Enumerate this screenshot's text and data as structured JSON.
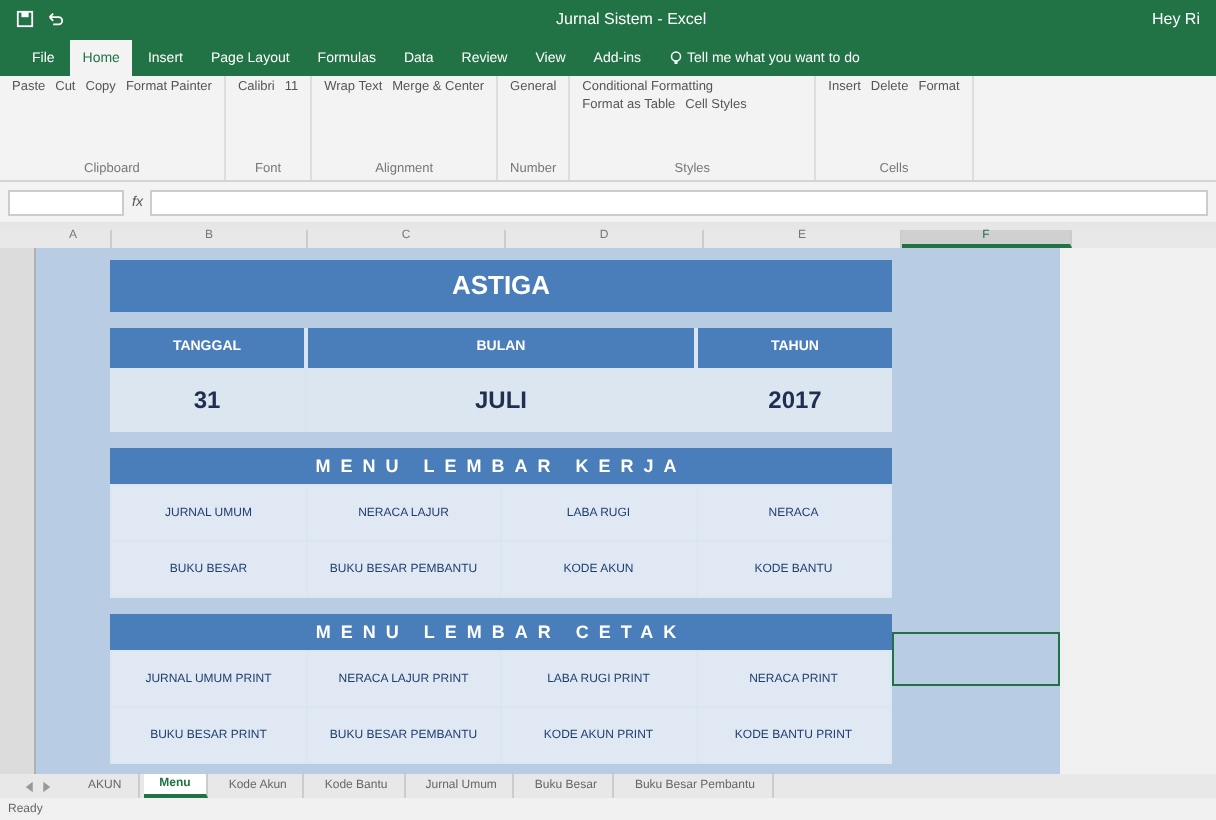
{
  "window": {
    "title": "Jurnal Sistem - Excel",
    "user": "Hey Ri"
  },
  "ribbon_tabs": [
    {
      "label": "File",
      "selected": false
    },
    {
      "label": "Home",
      "selected": true
    },
    {
      "label": "Insert",
      "selected": false
    },
    {
      "label": "Page Layout",
      "selected": false
    },
    {
      "label": "Formulas",
      "selected": false
    },
    {
      "label": "Data",
      "selected": false
    },
    {
      "label": "Review",
      "selected": false
    },
    {
      "label": "View",
      "selected": false
    },
    {
      "label": "Add-ins",
      "selected": false
    }
  ],
  "tell_me": "Tell me what you want to do",
  "ribbon_groups": [
    {
      "label": "Clipboard",
      "items": [
        "Paste",
        "Cut",
        "Copy",
        "Format Painter"
      ]
    },
    {
      "label": "Font",
      "items": [
        "Calibri",
        "11"
      ]
    },
    {
      "label": "Alignment",
      "items": [
        "Wrap Text",
        "Merge & Center"
      ]
    },
    {
      "label": "Number",
      "items": [
        "General"
      ]
    },
    {
      "label": "Styles",
      "items": [
        "Conditional Formatting",
        "Format as Table",
        "Cell Styles"
      ]
    },
    {
      "label": "Cells",
      "items": [
        "Insert",
        "Delete",
        "Format"
      ]
    }
  ],
  "formula_bar": {
    "fx": "fx"
  },
  "column_headers": [
    {
      "label": "A",
      "selected": false
    },
    {
      "label": "B",
      "selected": false
    },
    {
      "label": "C",
      "selected": false
    },
    {
      "label": "D",
      "selected": false
    },
    {
      "label": "E",
      "selected": false
    },
    {
      "label": "F",
      "selected": true
    }
  ],
  "dashboard": {
    "title": "ASTIGA",
    "date_headers": [
      "TANGGAL",
      "BULAN",
      "TAHUN"
    ],
    "date_values": [
      "31",
      "JULI",
      "2017"
    ],
    "sections": [
      {
        "title": "MENU LEMBAR KERJA",
        "rows": [
          [
            "JURNAL UMUM",
            "NERACA LAJUR",
            "LABA RUGI",
            "NERACA"
          ],
          [
            "BUKU BESAR",
            "BUKU BESAR PEMBANTU",
            "KODE AKUN",
            "KODE BANTU"
          ]
        ]
      },
      {
        "title": "MENU LEMBAR CETAK",
        "rows": [
          [
            "JURNAL UMUM PRINT",
            "NERACA LAJUR PRINT",
            "LABA RUGI PRINT",
            "NERACA PRINT"
          ],
          [
            "BUKU BESAR PRINT",
            "BUKU BESAR PEMBANTU",
            "KODE AKUN PRINT",
            "KODE BANTU PRINT"
          ]
        ]
      }
    ]
  },
  "sheet_tabs": [
    {
      "label": "AKUN",
      "selected": false
    },
    {
      "label": "Menu",
      "selected": true
    },
    {
      "label": "Kode Akun",
      "selected": false
    },
    {
      "label": "Kode Bantu",
      "selected": false
    },
    {
      "label": "Jurnal Umum",
      "selected": false
    },
    {
      "label": "Buku Besar",
      "selected": false
    },
    {
      "label": "Buku Besar Pembantu",
      "selected": false
    }
  ],
  "status": "Ready"
}
